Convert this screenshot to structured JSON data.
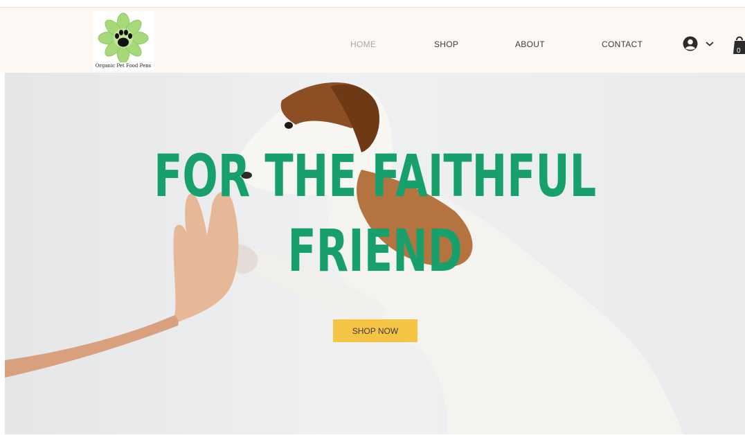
{
  "brand": {
    "logo_text": "Organic Pet Food Pens"
  },
  "nav": {
    "items": [
      {
        "label": "HOME",
        "active": true
      },
      {
        "label": "SHOP",
        "active": false
      },
      {
        "label": "ABOUT",
        "active": false
      },
      {
        "label": "CONTACT",
        "active": false
      }
    ]
  },
  "header": {
    "cart_count": "0"
  },
  "hero": {
    "title_line1": "FOR THE FAITHFUL",
    "title_line2": "FRIEND",
    "cta_label": "SHOP NOW"
  },
  "colors": {
    "header_bg": "#fdf8f4",
    "headline_green": "#17a06b",
    "cta_yellow": "#f6c445",
    "logo_leaf": "#a7d87a"
  },
  "icons": [
    "paw-icon",
    "user-icon",
    "chevron-down-icon",
    "shopping-bag-icon"
  ]
}
